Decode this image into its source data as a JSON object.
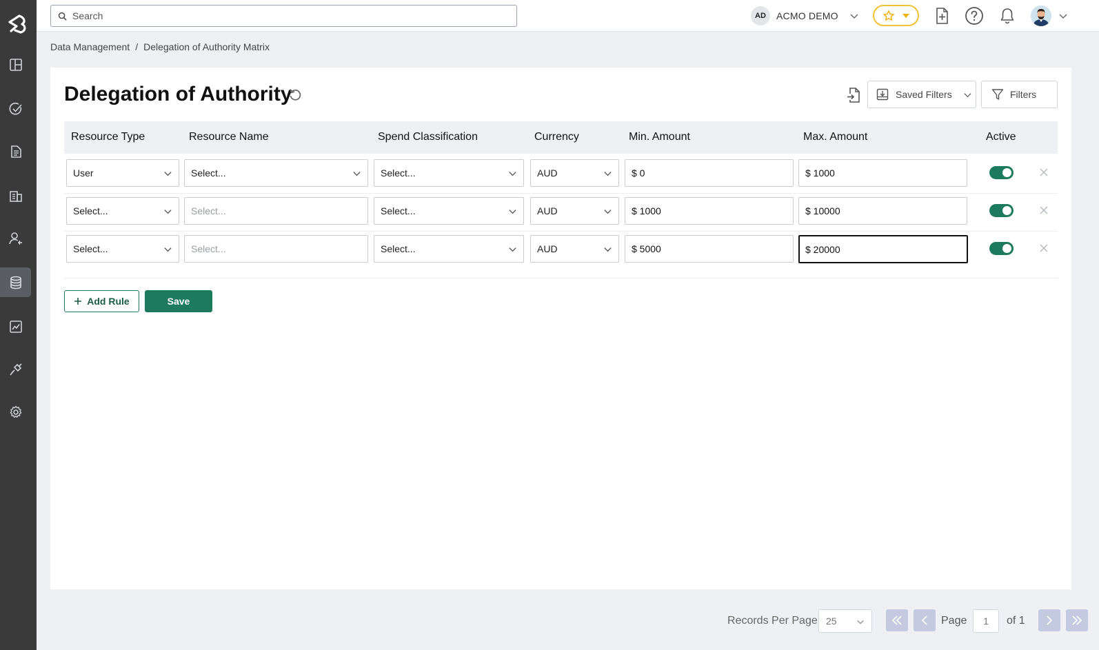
{
  "search": {
    "placeholder": "Search"
  },
  "org": {
    "initials": "AD",
    "name": "ACMO DEMO"
  },
  "sidebar": {
    "items": [
      {
        "icon": "dashboard-icon"
      },
      {
        "icon": "tasks-icon"
      },
      {
        "icon": "documents-icon"
      },
      {
        "icon": "buildings-icon"
      },
      {
        "icon": "user-add-icon"
      },
      {
        "icon": "database-icon",
        "active": true
      },
      {
        "icon": "analytics-icon"
      },
      {
        "icon": "integrations-icon"
      },
      {
        "icon": "settings-icon"
      }
    ]
  },
  "breadcrumb": {
    "items": [
      "Data Management",
      "Delegation of Authority Matrix"
    ],
    "separator": "/"
  },
  "page": {
    "title": "Delegation of Authority"
  },
  "toolbar": {
    "saved_filters_label": "Saved Filters",
    "filters_label": "Filters"
  },
  "table": {
    "columns": [
      "Resource Type",
      "Resource Name",
      "Spend Classification",
      "Currency",
      "Min. Amount",
      "Max. Amount",
      "Active"
    ],
    "rows": [
      {
        "resource_type": "User",
        "resource_name": "Select...",
        "spend_classification": "Select...",
        "currency": "AUD",
        "min": "$ 0",
        "max": "$ 1000",
        "active": true
      },
      {
        "resource_type": "Select...",
        "resource_name": "Select...",
        "spend_classification": "Select...",
        "currency": "AUD",
        "min": "$ 1000",
        "max": "$ 10000",
        "active": true
      },
      {
        "resource_type": "Select...",
        "resource_name": "Select...",
        "spend_classification": "Select...",
        "currency": "AUD",
        "min": "$ 5000",
        "max": "$ 20000",
        "active": true
      }
    ]
  },
  "actions": {
    "add_rule_label": "Add Rule",
    "save_label": "Save"
  },
  "pagination": {
    "records_per_page_label": "Records Per Page",
    "records_per_page": "25",
    "page_label": "Page",
    "current_page": "1",
    "total_label": "of 1"
  },
  "colors": {
    "primary": "#1d7a5c",
    "sidebar": "#3a3a3a",
    "favorite": "#f2c232",
    "pager_button": "#c4cbe0"
  }
}
